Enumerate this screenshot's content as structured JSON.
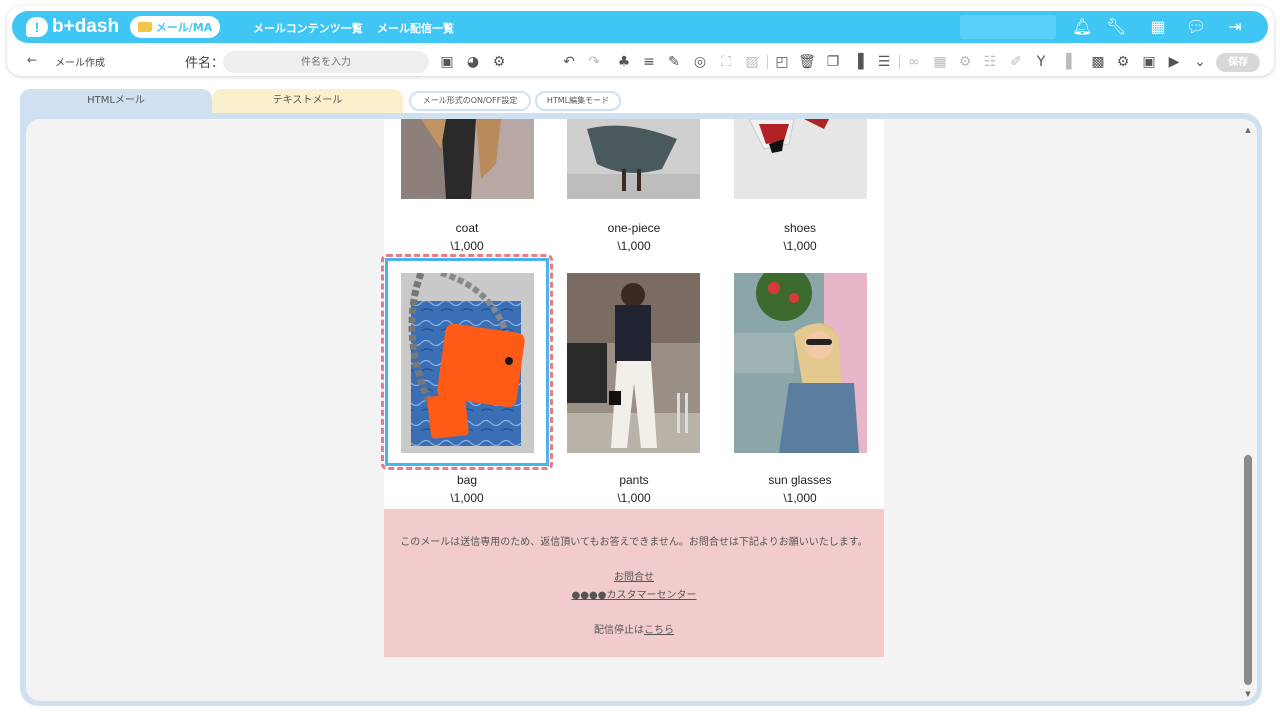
{
  "header": {
    "logo_text": "b+dash",
    "menu_pill": "メール/MA",
    "nav": [
      "メールコンテンツ一覧",
      "メール配信一覧"
    ],
    "icons": [
      "bell-icon",
      "wrench-icon",
      "grid-icon",
      "chat-icon",
      "logout-icon"
    ]
  },
  "toolbar": {
    "back": "←",
    "page_title": "メール作成",
    "subject_label": "件名：",
    "subject_placeholder": "件名を入力",
    "subject_value": "",
    "save_label": "保存"
  },
  "tabs": {
    "html": "HTMLメール",
    "text": "テキストメール",
    "toggle": "メール形式のON/OFF設定",
    "html_edit": "HTML編集モード"
  },
  "products_row1": [
    {
      "name": "coat",
      "price": "\\1,000"
    },
    {
      "name": "one-piece",
      "price": "\\1,000"
    },
    {
      "name": "shoes",
      "price": "\\1,000"
    }
  ],
  "products_row2": [
    {
      "name": "bag",
      "price": "\\1,000"
    },
    {
      "name": "pants",
      "price": "\\1,000"
    },
    {
      "name": "sun glasses",
      "price": "\\1,000"
    }
  ],
  "footer": {
    "note": "このメールは送信専用のため、返信頂いてもお答えできません。お問合せは下記よりお願いいたします。",
    "contact_link": "お問合せ",
    "center_link": "●●●●カスタマーセンター",
    "stop_prefix": "配信停止は",
    "stop_link": "こちら"
  },
  "colors": {
    "brand": "#3fc6f5",
    "tab_html": "#cfe1f1",
    "tab_text": "#fbefcd",
    "footer_bg": "#f2cccc",
    "selection_dashed": "#e87a8a",
    "selection_solid": "#48b4e8"
  }
}
